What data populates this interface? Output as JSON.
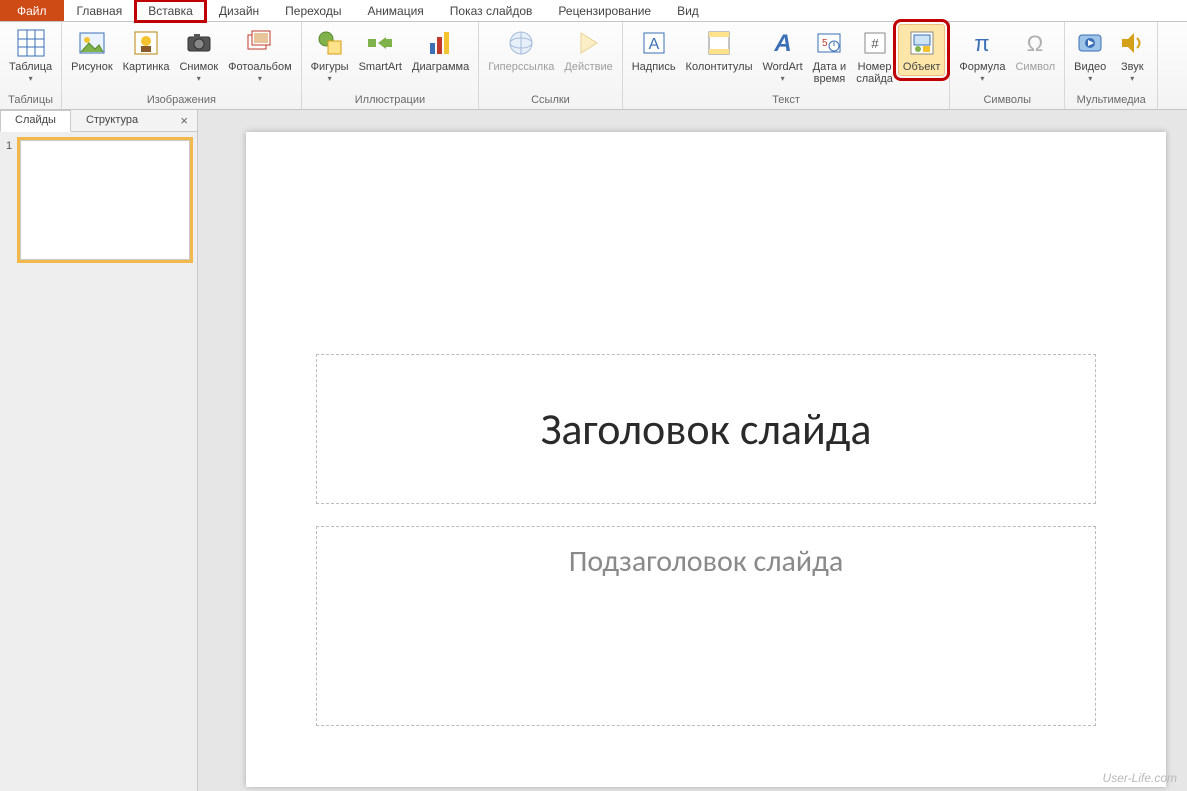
{
  "tabs": {
    "file": "Файл",
    "home": "Главная",
    "insert": "Вставка",
    "design": "Дизайн",
    "transitions": "Переходы",
    "animation": "Анимация",
    "slideshow": "Показ слайдов",
    "review": "Рецензирование",
    "view": "Вид"
  },
  "ribbon": {
    "tables": {
      "table": "Таблица",
      "group": "Таблицы"
    },
    "images": {
      "picture": "Рисунок",
      "clipart": "Картинка",
      "screenshot": "Снимок",
      "album": "Фотоальбом",
      "group": "Изображения"
    },
    "illustrations": {
      "shapes": "Фигуры",
      "smartart": "SmartArt",
      "chart": "Диаграмма",
      "group": "Иллюстрации"
    },
    "links": {
      "hyperlink": "Гиперссылка",
      "action": "Действие",
      "group": "Ссылки"
    },
    "text": {
      "textbox": "Надпись",
      "headerfooter": "Колонтитулы",
      "wordart": "WordArt",
      "datetime": "Дата и\nвремя",
      "slidenum": "Номер\nслайда",
      "object": "Объект",
      "group": "Текст"
    },
    "symbols": {
      "equation": "Формула",
      "symbol": "Символ",
      "group": "Символы"
    },
    "media": {
      "video": "Видео",
      "audio": "Звук",
      "group": "Мультимедиа"
    }
  },
  "panel": {
    "slides": "Слайды",
    "outline": "Структура",
    "close": "×",
    "num1": "1"
  },
  "slide": {
    "title": "Заголовок слайда",
    "subtitle": "Подзаголовок слайда"
  },
  "watermark": "User-Life.com"
}
